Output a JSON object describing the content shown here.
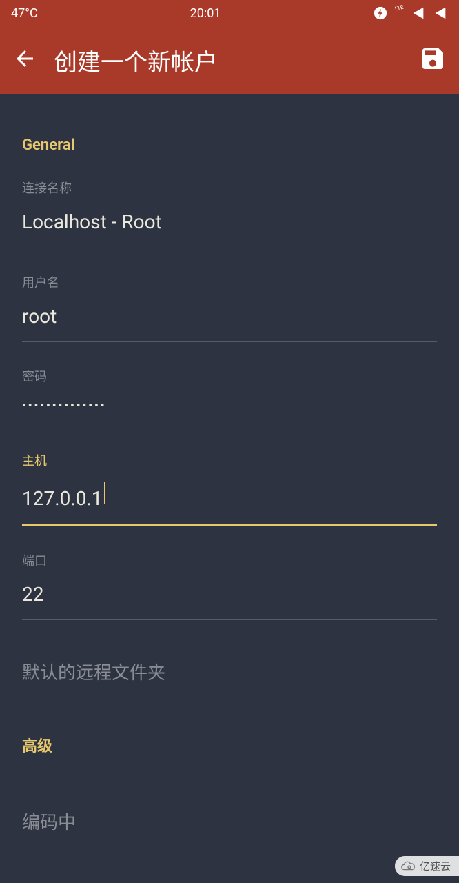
{
  "status": {
    "temperature": "47°C",
    "time": "20:01",
    "network_badge": "LTE"
  },
  "header": {
    "title": "创建一个新帐户"
  },
  "sections": {
    "general": "General",
    "advanced": "高级"
  },
  "fields": {
    "connection_name": {
      "label": "连接名称",
      "value": "Localhost - Root"
    },
    "username": {
      "label": "用户名",
      "value": "root"
    },
    "password": {
      "label": "密码",
      "value": "••••••••••••••"
    },
    "host": {
      "label": "主机",
      "value": "127.0.0.1"
    },
    "port": {
      "label": "端口",
      "value": "22"
    },
    "remote_folder": {
      "label": "默认的远程文件夹",
      "value": ""
    },
    "encoding": {
      "label": "编码中",
      "value": ""
    }
  },
  "watermark": "亿速云",
  "colors": {
    "accent": "#e8c86e",
    "brand_bar": "#a93a2a",
    "background": "#2d3340"
  }
}
